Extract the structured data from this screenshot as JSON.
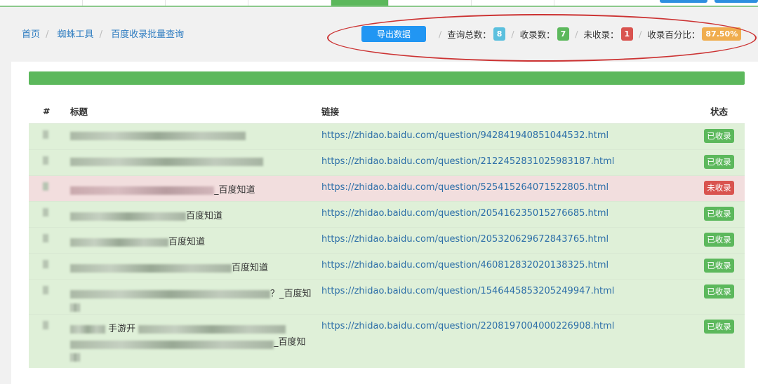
{
  "breadcrumb": [
    "首页",
    "蜘蛛工具",
    "百度收录批量查询"
  ],
  "toolbar": {
    "export_label": "导出数据",
    "total_label": "查询总数：",
    "total": "8",
    "indexed_label": "收录数：",
    "indexed": "7",
    "unindexed_label": "未收录：",
    "unindexed": "1",
    "percent_label": "收录百分比：",
    "percent": "87.50%"
  },
  "colors": {
    "info": "#5bc0de",
    "success": "#5cb85c",
    "danger": "#d9534f",
    "warning": "#f0ad4e",
    "primary": "#2196f3"
  },
  "table": {
    "headers": [
      "#",
      "标题",
      "链接",
      "状态"
    ],
    "rows": [
      {
        "title_suffix": "",
        "link": "https://zhidao.baidu.com/question/942841940851044532.html",
        "status": "已收录",
        "ok": true
      },
      {
        "title_suffix": "",
        "link": "https://zhidao.baidu.com/question/2122452831025983187.html",
        "status": "已收录",
        "ok": true
      },
      {
        "title_suffix": "_百度知道",
        "link": "https://zhidao.baidu.com/question/525415264071522805.html",
        "status": "未收录",
        "ok": false
      },
      {
        "title_suffix": "百度知道",
        "link": "https://zhidao.baidu.com/question/205416235015276685.html",
        "status": "已收录",
        "ok": true
      },
      {
        "title_suffix": "百度知道",
        "link": "https://zhidao.baidu.com/question/205320629672843765.html",
        "status": "已收录",
        "ok": true
      },
      {
        "title_suffix": "百度知道",
        "link": "https://zhidao.baidu.com/question/460812832020138325.html",
        "status": "已收录",
        "ok": true
      },
      {
        "title_suffix": "？_百度知",
        "link": "https://zhidao.baidu.com/question/1546445853205249947.html",
        "status": "已收录",
        "ok": true
      },
      {
        "title_mid": "手游开",
        "title_suffix": "_百度知",
        "link": "https://zhidao.baidu.com/question/2208197004000226908.html",
        "status": "已收录",
        "ok": true
      }
    ]
  }
}
